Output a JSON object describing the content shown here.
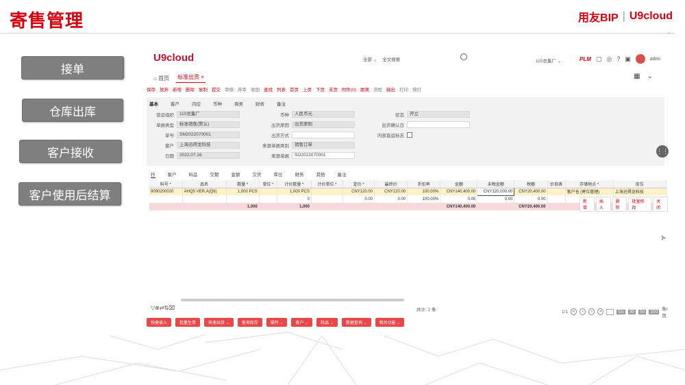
{
  "slide": {
    "title": "寄售管理",
    "brand_left": "用友BIP",
    "brand_sep": "|",
    "brand_right": "U9cloud"
  },
  "side_buttons": [
    "接单",
    "仓库出库",
    "客户接收",
    "客户使用后结算"
  ],
  "app": {
    "logo": "U9cloud",
    "search_scope": "全部 ⌄",
    "search_placeholder": "全文搜索",
    "org_selector": "110总集厂 ⌄",
    "plm_label": "PLM",
    "user": "admi",
    "home_tab": "首页",
    "active_tab": "标准出货 ×",
    "toolbar": [
      "保存",
      "放弃",
      "新增",
      "删除",
      "复制",
      "提交",
      "审核",
      "弃审",
      "收回",
      "查找",
      "列表",
      "首页",
      "上页",
      "下页",
      "末页",
      "附件(0)",
      "脱离",
      "流程",
      "输出",
      "打印",
      "快打"
    ],
    "form_tabs": [
      "基本",
      "客户",
      "内控",
      "币种",
      "商务",
      "财务",
      "备注"
    ],
    "fields": {
      "org_label": "营运组织",
      "org_value": "110总集厂",
      "currency_label": "币种",
      "currency_value": "人民币元",
      "status_label": "状态",
      "status_value": "开立",
      "doctype_label": "单据类型",
      "doctype_value": "标准销售(默认)",
      "ship_reason_label": "出货原因",
      "ship_reason_value": "出货原则",
      "ship_confirm_label": "出货确认日",
      "docno_label": "单号",
      "docno_value": "SM2022070001",
      "ship_method_label": "出货方式",
      "internal_label": "内部直运标志",
      "customer_label": "客户",
      "customer_value": "上海迅得龙科技",
      "src_type_label": "来源单据类别",
      "src_type_value": "销售订单",
      "date_label": "日期",
      "date_value": "2022.07.16",
      "src_doc_label": "来源单据",
      "src_doc_value": "SO2022070001"
    },
    "grid_tabs": [
      "行",
      "客户",
      "料品",
      "交期",
      "金额",
      "交货",
      "库位",
      "财务",
      "其他",
      "备注"
    ],
    "grid": {
      "headers": [
        "料号 *",
        "品名",
        "数量 *",
        "单位 *",
        "计价数量 *",
        "计价单位 *",
        "定价 *",
        "最终价",
        "折扣率",
        "金额",
        "未税金额",
        "税额",
        "价目表",
        "存储地点 *",
        "库位"
      ],
      "rows": [
        [
          "9090200020",
          "AHQ5 VER.A(Q8)",
          "1,000 PCS",
          "",
          "1,000 PCS",
          "",
          "CNY120.00",
          "CNY120.00",
          "100.00%",
          "CNY140,400.00",
          "CNY120,000.00",
          "CNY20,400.00",
          "",
          "客户仓 (寄位管理)",
          "上海迅得龙科技"
        ],
        [
          "",
          "",
          "",
          "",
          "0",
          "",
          "0.00",
          "0.00",
          "100.00%",
          "0.00",
          "0.00",
          "0.00",
          "",
          "",
          ""
        ]
      ],
      "total": [
        "",
        "",
        "1,000",
        "",
        "1,000",
        "",
        "",
        "",
        "",
        "CNY140,400.00",
        "",
        "CNY20,400.00",
        "",
        "",
        ""
      ]
    },
    "row_buttons": [
      "新增",
      "插入",
      "删除",
      "批量修改",
      "关闭"
    ],
    "pager": {
      "total_text": "共计: 1 条",
      "page": "1/1",
      "go": "Go",
      "sizes": [
        "30",
        "50",
        "200"
      ],
      "per_page": "条/页"
    },
    "actions": [
      "快捷录入",
      "批量生单",
      "快速出货 ⌄",
      "查询库存",
      "操作 ⌄",
      "客户 ⌄",
      "料品 ⌄",
      "数据查询 ⌄",
      "相关功能 ⌄"
    ]
  }
}
